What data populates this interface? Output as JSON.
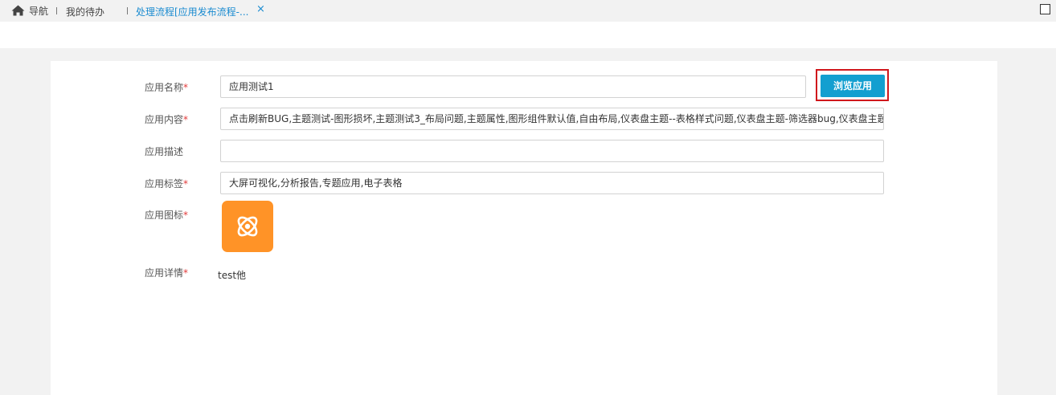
{
  "topbar": {
    "home_label": "导航",
    "tabs": [
      {
        "label": "我的待办"
      },
      {
        "label": "处理流程[应用发布流程-..."
      }
    ],
    "close_glyph": "×"
  },
  "form": {
    "name_label": "应用名称",
    "name_value": "应用测试1",
    "browse_button": "浏览应用",
    "content_label": "应用内容",
    "content_value": "点击刷新BUG,主题测试-图形损坏,主题测试3_布局问题,主题属性,图形组件默认值,自由布局,仪表盘主题--表格样式问题,仪表盘主题-筛选器bug,仪表盘主题",
    "desc_label": "应用描述",
    "desc_value": "",
    "tags_label": "应用标签",
    "tags_value": "大屏可视化,分析报告,专题应用,电子表格",
    "icon_label": "应用图标",
    "detail_label": "应用详情",
    "detail_value": "test他",
    "required_mark": "*"
  },
  "colors": {
    "accent": "#139fd0",
    "highlight": "#d0171c",
    "app_icon_bg": "#ff9327",
    "required": "#e23b3b"
  },
  "icons": {
    "home": "home-icon",
    "close": "close-icon",
    "maximize": "maximize-icon",
    "app": "atom-icon"
  }
}
